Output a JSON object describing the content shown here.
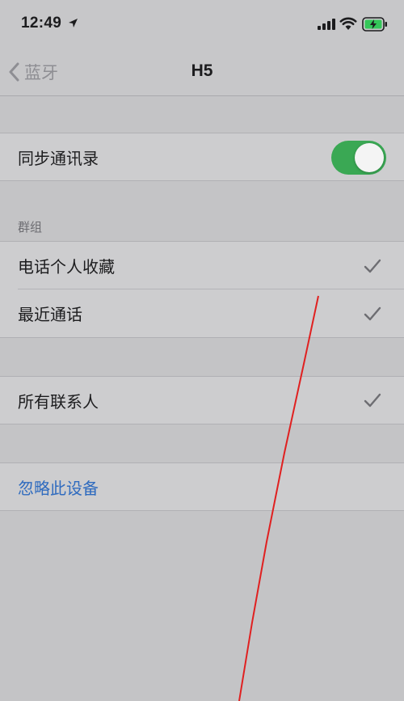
{
  "status": {
    "time": "12:49"
  },
  "nav": {
    "back_label": "蓝牙",
    "title": "H5"
  },
  "sync_contacts": {
    "label": "同步通讯录",
    "enabled": true
  },
  "groups": {
    "header": "群组",
    "items": [
      {
        "label": "电话个人收藏",
        "checked": true
      },
      {
        "label": "最近通话",
        "checked": true
      }
    ]
  },
  "all_contacts": {
    "label": "所有联系人",
    "checked": true
  },
  "ignore_device": {
    "label": "忽略此设备"
  },
  "colors": {
    "toggle_on": "#3aa854",
    "link_blue": "#2f6bbf",
    "annotation_red": "#e02020"
  }
}
